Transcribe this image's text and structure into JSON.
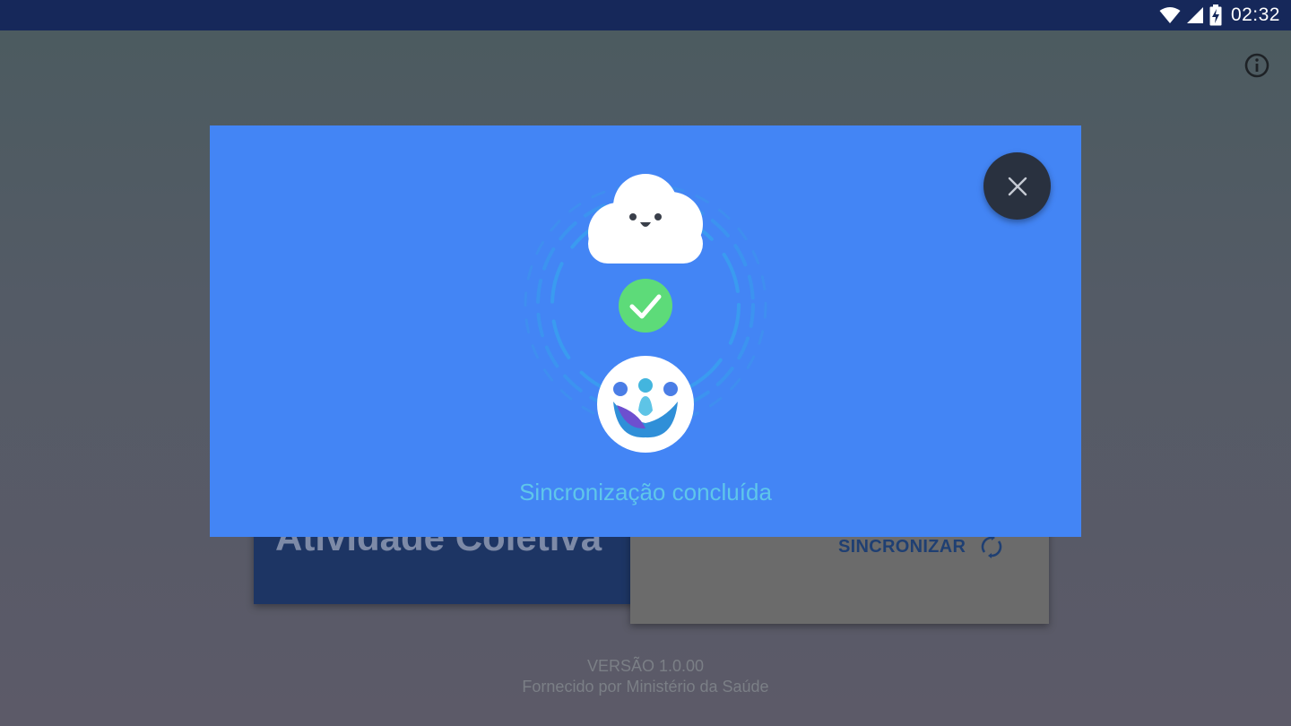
{
  "status_bar": {
    "time": "02:32",
    "icons": [
      "wifi-icon",
      "cell-signal-icon",
      "battery-charging-icon"
    ]
  },
  "background_screen": {
    "info_icon": "info-icon",
    "activity_card_title": "Atividade Coletiva",
    "sync_button_label": "SINCRONIZAR",
    "sync_icon": "sync-icon",
    "version": "VERSÃO 1.0.00",
    "provider": "Fornecido por Ministério da Saúde"
  },
  "modal": {
    "close_icon": "close-icon",
    "cloud_icon": "smiling-cloud-icon",
    "check_icon": "check-icon",
    "logo": "app-logo",
    "message": "Sincronização concluída"
  },
  "colors": {
    "status_bar": "#16285a",
    "modal_background": "#4385f5",
    "close_button": "#29313f",
    "success_green": "#5ddb79",
    "message_text": "#5fc6ea"
  }
}
